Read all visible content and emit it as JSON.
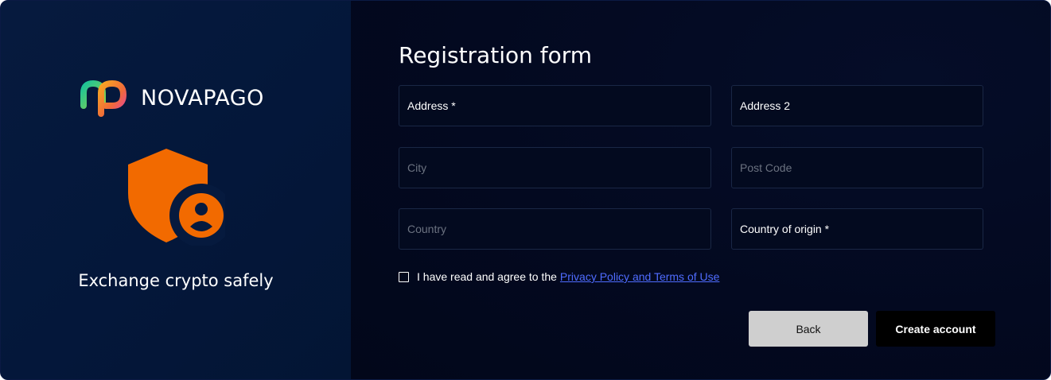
{
  "brand": {
    "name": "NOVAPAGO",
    "tagline": "Exchange crypto safely",
    "colors": {
      "accent_orange": "#f26a00",
      "logo_green": "#19c39a",
      "logo_gradient_end": "#f5a623",
      "link_blue": "#4f6cff"
    },
    "logo_icon": "novapago-logo-icon",
    "hero_icon": "shield-user-icon"
  },
  "form": {
    "title": "Registration form",
    "fields": {
      "address": {
        "label": "Address *"
      },
      "address2": {
        "label": "Address 2"
      },
      "city": {
        "placeholder": "City"
      },
      "postcode": {
        "placeholder": "Post Code"
      },
      "country": {
        "placeholder": "Country"
      },
      "country_of_origin": {
        "label": "Country of origin *"
      }
    },
    "agree": {
      "text": "I have read and agree to the",
      "link": "Privacy Policy and Terms of Use",
      "checked": false
    },
    "buttons": {
      "back": "Back",
      "create": "Create account"
    }
  }
}
